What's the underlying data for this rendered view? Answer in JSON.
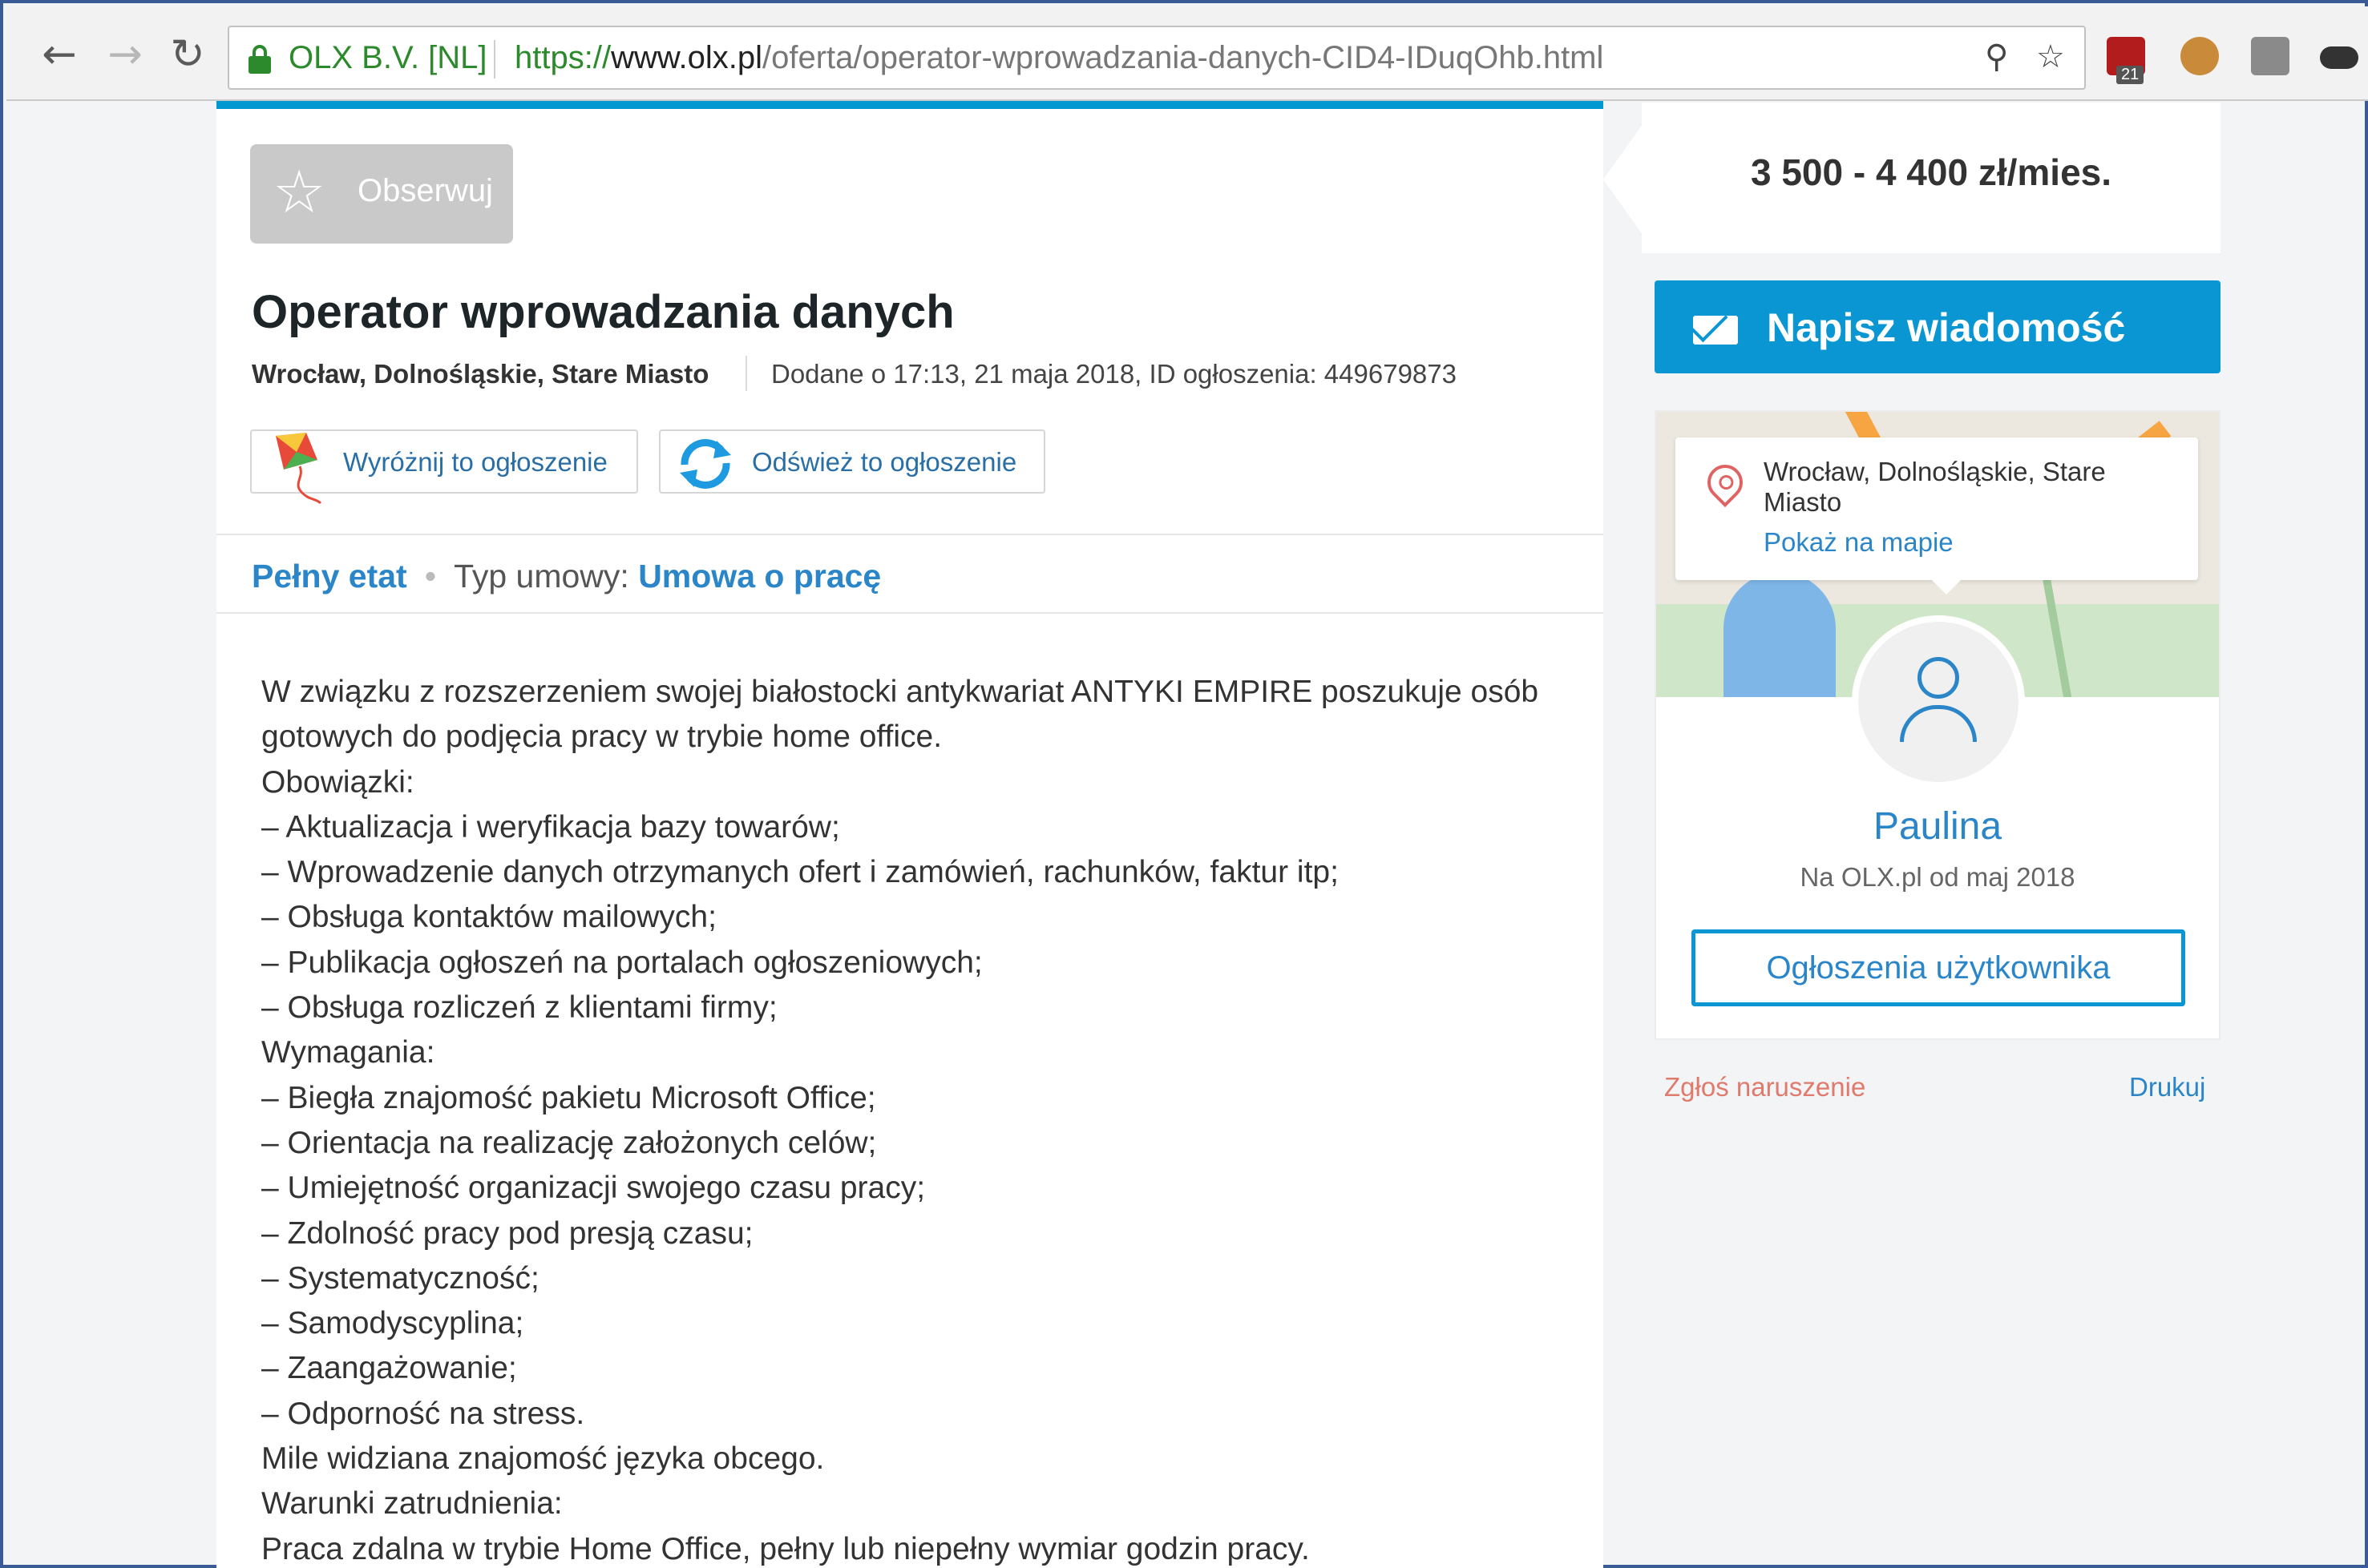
{
  "browser": {
    "back_icon": "arrow-left-icon",
    "forward_icon": "arrow-right-icon",
    "reload_icon": "reload-icon",
    "org": "OLX B.V. [NL]",
    "url_scheme": "https://",
    "url_host": "www.olx.pl",
    "url_path": "/oferta/operator-wprowadzania-danych-CID4-IDuqOhb.html",
    "extension_badge": "21"
  },
  "ad": {
    "follow_label": "Obserwuj",
    "title": "Operator wprowadzania danych",
    "location": "Wrocław, Dolnośląskie, Stare Miasto",
    "meta": "Dodane o 17:13, 21 maja 2018, ID ogłoszenia: 449679873",
    "promote_label": "Wyróżnij to ogłoszenie",
    "refresh_label": "Odśwież to ogłoszenie",
    "tag_fulltime": "Pełny etat",
    "contract_label": "Typ umowy:",
    "contract_value": "Umowa o pracę",
    "description": [
      "W związku z rozszerzeniem swojej białostocki antykwariat ANTYKI EMPIRE poszukuje osób",
      "gotowych do podjęcia pracy w trybie home office.",
      "Obowiązki:",
      "– Aktualizacja i weryfikacja bazy towarów;",
      "– Wprowadzenie danych otrzymanych ofert i zamówień, rachunków, faktur itp;",
      "– Obsługa kontaktów mailowych;",
      "– Publikacja ogłoszeń na portalach ogłoszeniowych;",
      "– Obsługa rozliczeń z klientami firmy;",
      "Wymagania:",
      "– Biegła znajomość pakietu Microsoft Office;",
      "– Orientacja na realizację założonych celów;",
      "– Umiejętność organizacji swojego czasu pracy;",
      "– Zdolność pracy pod presją czasu;",
      "– Systematyczność;",
      "– Samodyscyplina;",
      "– Zaangażowanie;",
      "– Odporność na stress.",
      "Mile widziana znajomość języka obcego.",
      "Warunki zatrudnienia:",
      "Praca zdalna w trybie Home Office, pełny lub niepełny wymiar godzin pracy."
    ]
  },
  "sidebar": {
    "price": "3 500 - 4 400 zł/mies.",
    "message_label": "Napisz wiadomość",
    "map_address": "Wrocław, Dolnośląskie, Stare Miasto",
    "map_link": "Pokaż na mapie",
    "seller_name": "Paulina",
    "seller_since": "Na OLX.pl od maj 2018",
    "user_ads_label": "Ogłoszenia użytkownika",
    "report_label": "Zgłoś naruszenie",
    "print_label": "Drukuj"
  },
  "colors": {
    "accent": "#0a96d3",
    "link": "#2a86c8",
    "secure": "#2c8a2c",
    "report": "#e07a6d"
  }
}
